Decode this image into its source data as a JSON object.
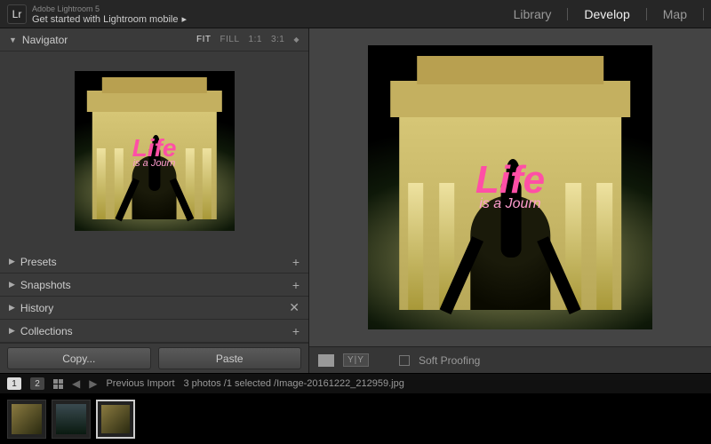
{
  "header": {
    "logo_text": "Lr",
    "brand_small": "Adobe Lightroom 5",
    "brand_sub": "Get started with Lightroom mobile",
    "modules": {
      "library": "Library",
      "develop": "Develop",
      "map": "Map"
    }
  },
  "navigator": {
    "title": "Navigator",
    "fit": "FIT",
    "fill": "FILL",
    "one": "1:1",
    "three": "3:1"
  },
  "panels": {
    "presets": "Presets",
    "snapshots": "Snapshots",
    "history": "History",
    "collections": "Collections"
  },
  "buttons": {
    "copy": "Copy...",
    "paste": "Paste"
  },
  "toolbar": {
    "yy": "Y|Y",
    "soft_proof": "Soft Proofing"
  },
  "image_text": {
    "line1": "Life",
    "line2": "is a Journ"
  },
  "filmstrip": {
    "page1": "1",
    "page2": "2",
    "source": "Previous Import",
    "stats": "3 photos /1 selected /Image-20161222_212959.jpg"
  }
}
